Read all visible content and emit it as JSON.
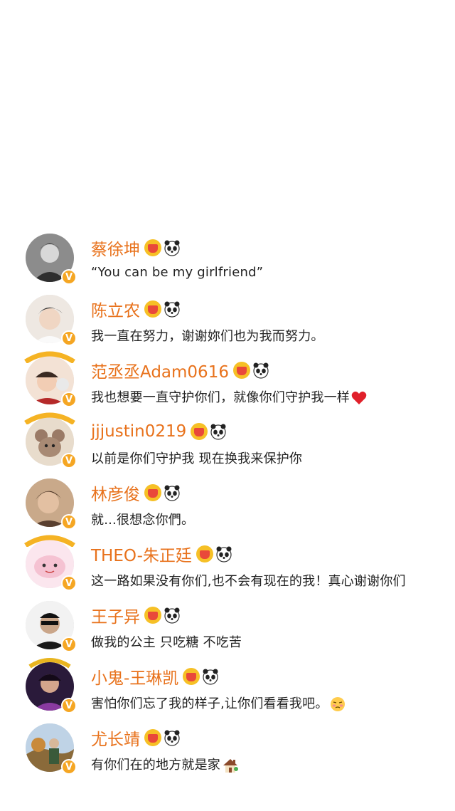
{
  "rows": [
    {
      "name": "蔡徐坤",
      "message": "“You can be my girlfriend”",
      "avatar_color": "#6e6e6e",
      "extra_emoji": ""
    },
    {
      "name": "陈立农",
      "message": "我一直在努力，谢谢妳们也为我而努力。",
      "avatar_color": "#c9b8aa",
      "extra_emoji": ""
    },
    {
      "name": "范丞丞Adam0616",
      "message": "我也想要一直守护你们，就像你们守护我一样",
      "avatar_color": "#d9a38c",
      "extra_emoji": "heart-emoji"
    },
    {
      "name": "jjjustin0219",
      "message": "以前是你们守护我  现在换我来保护你",
      "avatar_color": "#b08f7a",
      "extra_emoji": ""
    },
    {
      "name": "林彦俊",
      "message": "就...很想念你們。",
      "avatar_color": "#7a5a45",
      "extra_emoji": ""
    },
    {
      "name": "THEO-朱正廷",
      "message": "这一路如果没有你们,也不会有现在的我！真心谢谢你们",
      "avatar_color": "#f2c9d9",
      "extra_emoji": ""
    },
    {
      "name": "王子异",
      "message": "做我的公主 只吃糖 不吃苦",
      "avatar_color": "#3a3a3a",
      "extra_emoji": ""
    },
    {
      "name": "小鬼-王琳凯",
      "message": "害怕你们忘了我的样子,让你们看看我吧。",
      "avatar_color": "#5a3a7a",
      "extra_emoji": "shy-face-emoji"
    },
    {
      "name": "尤长靖",
      "message": "有你们在的地方就是家",
      "avatar_color": "#8aa07a",
      "extra_emoji": "house-emoji"
    }
  ],
  "colors": {
    "name": "#e8721c",
    "text": "#222222",
    "verified": "#f5a623",
    "background": "#ffffff"
  },
  "verified_mark": "V"
}
